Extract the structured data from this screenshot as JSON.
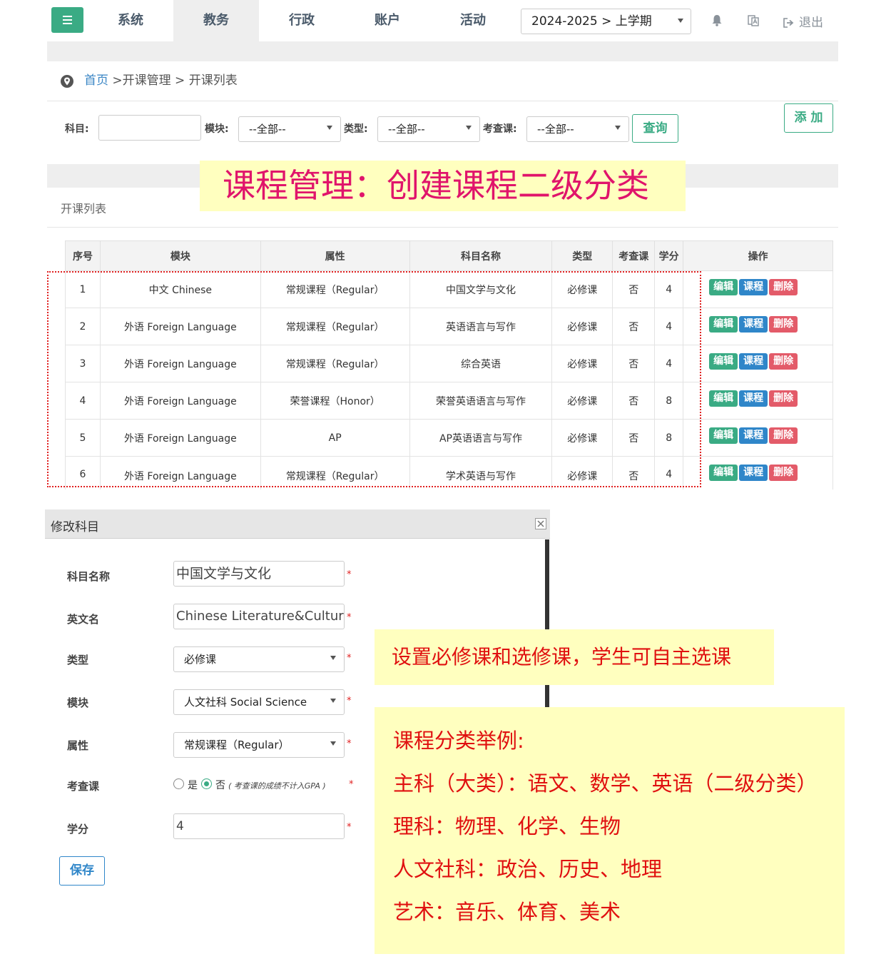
{
  "nav": {
    "items": [
      "系统",
      "教务",
      "行政",
      "账户",
      "活动"
    ],
    "active_index": 1,
    "term": "2024-2025 > 上学期",
    "logout": "退出"
  },
  "breadcrumb": {
    "home": "首页",
    "rest": " >开课管理 > 开课列表"
  },
  "filters": {
    "subject_label": "科目:",
    "module_label": "模块:",
    "type_label": "类型:",
    "exam_label": "考查课:",
    "all_option": "--全部--",
    "query_button": "查询",
    "add_button": "添 加"
  },
  "callout_title": "课程管理：创建课程二级分类",
  "section_title": "开课列表",
  "table": {
    "headers": [
      "序号",
      "模块",
      "属性",
      "科目名称",
      "类型",
      "考查课",
      "学分",
      "操作"
    ],
    "rows": [
      [
        "1",
        "中文 Chinese",
        "常规课程（Regular）",
        "中国文学与文化",
        "必修课",
        "否",
        "4"
      ],
      [
        "2",
        "外语 Foreign Language",
        "常规课程（Regular）",
        "英语语言与写作",
        "必修课",
        "否",
        "4"
      ],
      [
        "3",
        "外语 Foreign Language",
        "常规课程（Regular）",
        "综合英语",
        "必修课",
        "否",
        "4"
      ],
      [
        "4",
        "外语 Foreign Language",
        "荣誉课程（Honor）",
        "荣誉英语语言与写作",
        "必修课",
        "否",
        "8"
      ],
      [
        "5",
        "外语 Foreign Language",
        "AP",
        "AP英语语言与写作",
        "必修课",
        "否",
        "8"
      ],
      [
        "6",
        "外语 Foreign Language",
        "常规课程（Regular）",
        "学术英语与写作",
        "必修课",
        "否",
        "4"
      ]
    ],
    "actions": [
      "编辑",
      "课程",
      "删除"
    ]
  },
  "modal": {
    "title": "修改科目",
    "fields": {
      "name_label": "科目名称",
      "name_value": "中国文学与文化",
      "en_label": "英文名",
      "en_value": "Chinese Literature&Culture",
      "type_label": "类型",
      "type_value": "必修课",
      "module_label": "模块",
      "module_value": "人文社科 Social Science",
      "attr_label": "属性",
      "attr_value": "常规课程（Regular）",
      "exam_label": "考查课",
      "exam_yes": "是",
      "exam_no": "否",
      "exam_note": "( 考查课的成绩不计入GPA )",
      "credit_label": "学分",
      "credit_value": "4"
    },
    "required_mark": "*",
    "save_button": "保存"
  },
  "notes": {
    "elective": "设置必修课和选修课，学生可自主选课",
    "examples_title": "课程分类举例:",
    "examples": [
      "主科（大类）：语文、数学、英语（二级分类）",
      "理科：物理、化学、生物",
      "人文社科：政治、历史、地理",
      "艺术：音乐、体育、美术"
    ]
  },
  "colors": {
    "brand_green": "#3aab84",
    "blue": "#2f86c9",
    "red": "#e35b69",
    "callout_bg": "#ffffbf",
    "callout_text": "#e0146b",
    "note_text": "#e01010"
  }
}
